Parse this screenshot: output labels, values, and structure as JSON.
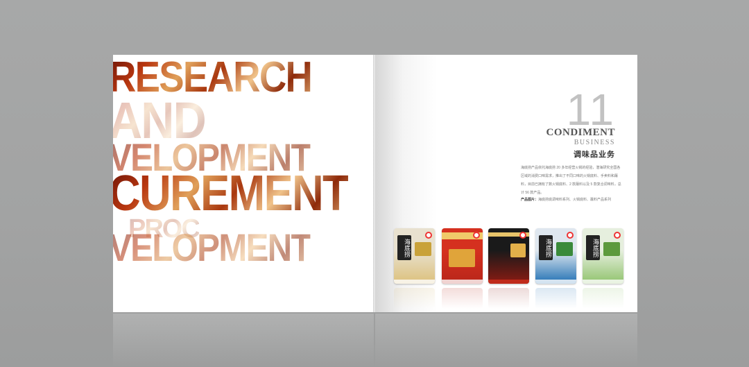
{
  "left_page": {
    "words": [
      "RESEARCH",
      "AND",
      "VELOPMENT",
      "CUREMENT",
      "PROC",
      "VELOPMENT"
    ]
  },
  "right_page": {
    "page_number": "11",
    "title_en": "CONDIMENT",
    "subtitle_en": "BUSINESS",
    "title_cn": "调味品业务",
    "body_text": "海底捞产品依托海底捞 20 多年经营火锅的经验，潜海研究全国各区域的消费口味需求，推出了不同口味的火锅底料、手卖料和蘸料，目前已拥有了数火锅底料、2 款蘸料以及 5 款复合调味料，总计 56 款产品。",
    "products_label": "产品图片：",
    "products_text": "海底捞底调味料系列、火锅底料、蘸料产品系列"
  },
  "packages": [
    {
      "brand_text": "海底捞",
      "label_text": "",
      "color_top": "#e8e1cf",
      "color_bottom": "#dcc07a",
      "label_color": "#c9a23a"
    },
    {
      "brand_text": "",
      "label_text": "",
      "color_top": "#d5301f",
      "color_bottom": "#b8261a",
      "label_color": "#e0a43a"
    },
    {
      "brand_text": "",
      "label_text": "",
      "color_top": "#1a1a1a",
      "color_bottom": "#8c1b12",
      "label_color": "#e3b04a"
    },
    {
      "brand_text": "海底捞",
      "label_text": "",
      "color_top": "#dfe7ef",
      "color_bottom": "#1f6fb3",
      "label_color": "#3a8a3a"
    },
    {
      "brand_text": "海底捞",
      "label_text": "",
      "color_top": "#e6efde",
      "color_bottom": "#8fc26b",
      "label_color": "#5d9a3d"
    }
  ]
}
